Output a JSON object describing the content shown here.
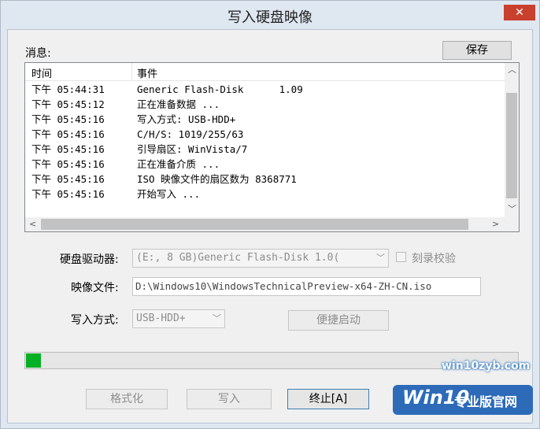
{
  "window": {
    "title": "写入硬盘映像",
    "close_glyph": "✕"
  },
  "messages": {
    "label": "消息:",
    "save_label": "保存",
    "columns": [
      "时间",
      "事件"
    ],
    "rows": [
      {
        "time": "下午 05:44:31",
        "event": "Generic Flash-Disk      1.09"
      },
      {
        "time": "下午 05:45:12",
        "event": "正在准备数据 ..."
      },
      {
        "time": "下午 05:45:16",
        "event": "写入方式: USB-HDD+"
      },
      {
        "time": "下午 05:45:16",
        "event": "C/H/S: 1019/255/63"
      },
      {
        "time": "下午 05:45:16",
        "event": "引导扇区: WinVista/7"
      },
      {
        "time": "下午 05:45:16",
        "event": "正在准备介质 ..."
      },
      {
        "time": "下午 05:45:16",
        "event": "ISO 映像文件的扇区数为 8368771"
      },
      {
        "time": "下午 05:45:16",
        "event": "开始写入 ..."
      }
    ]
  },
  "form": {
    "drive_label": "硬盘驱动器:",
    "drive_value": "(E:, 8 GB)Generic Flash-Disk      1.0(",
    "verify_label": "刻录校验",
    "image_label": "映像文件:",
    "image_value": "D:\\Windows10\\WindowsTechnicalPreview-x64-ZH-CN.iso",
    "method_label": "写入方式:",
    "method_value": "USB-HDD+",
    "quickboot_label": "便捷启动"
  },
  "progress": {
    "fraction": 0.03,
    "color": "#06b025"
  },
  "buttons": {
    "format_label": "格式化",
    "write_label": "写入",
    "abort_label": "终止[A]"
  },
  "watermark": {
    "url": "win10zyb.com",
    "logo_brand": "Win10",
    "logo_text": "专业版官网"
  }
}
